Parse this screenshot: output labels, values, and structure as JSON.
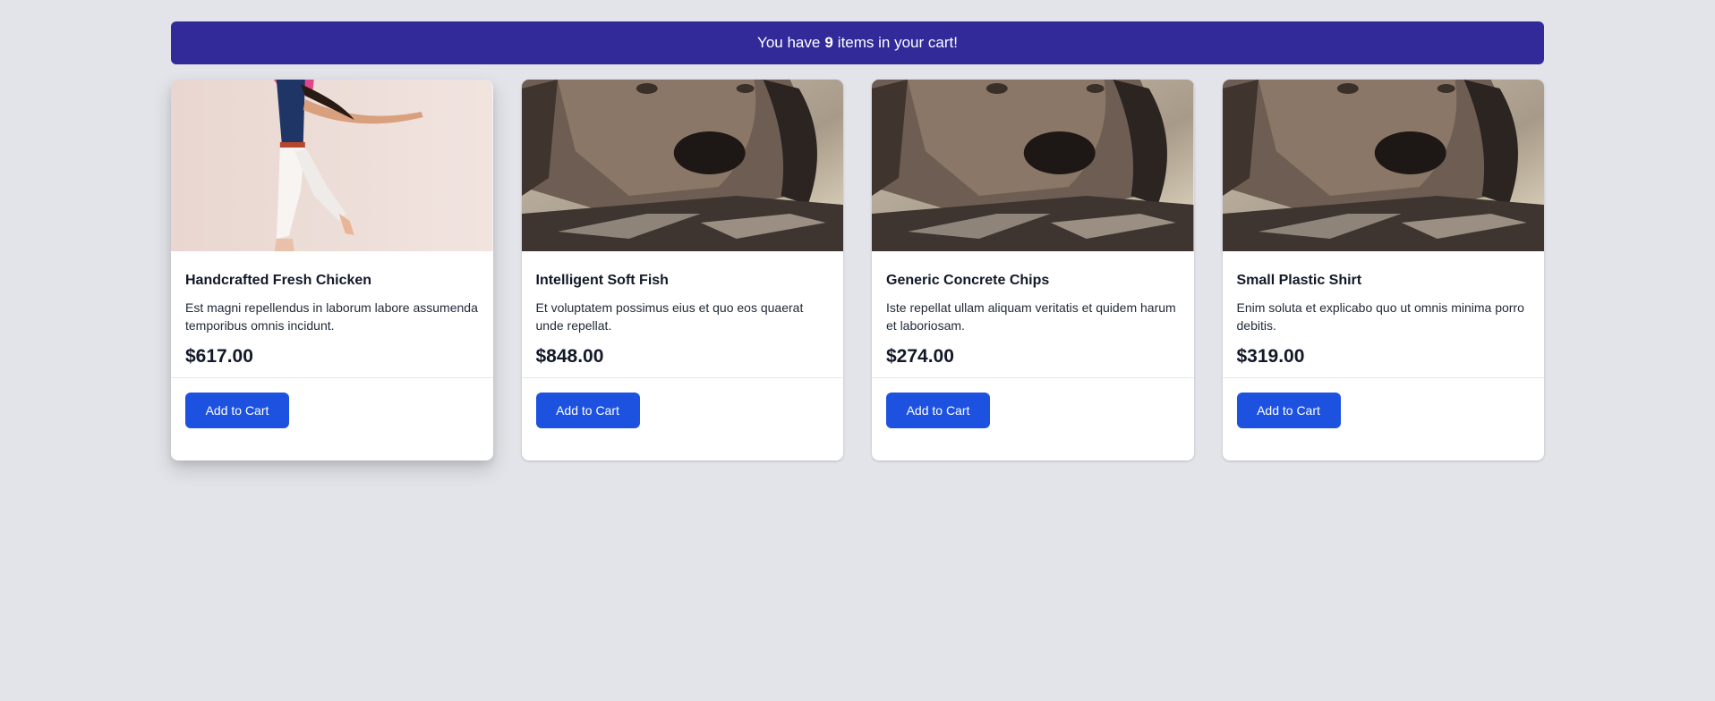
{
  "banner": {
    "prefix": "You have",
    "count": "9",
    "suffix": "items in your cart!",
    "color": "#312a98"
  },
  "products": [
    {
      "title": "Handcrafted Fresh Chicken",
      "description": "Est magni repellendus in laborum labore assumenda temporibus omnis incidunt.",
      "price": "$617.00",
      "button": "Add to Cart",
      "image": "woman-jumping-photo"
    },
    {
      "title": "Intelligent Soft Fish",
      "description": "Et voluptatem possimus eius et quo eos quaerat unde repellat.",
      "price": "$848.00",
      "button": "Add to Cart",
      "image": "dog-resting-photo"
    },
    {
      "title": "Generic Concrete Chips",
      "description": "Iste repellat ullam aliquam veritatis et quidem harum et laboriosam.",
      "price": "$274.00",
      "button": "Add to Cart",
      "image": "dog-resting-photo"
    },
    {
      "title": "Small Plastic Shirt",
      "description": "Enim soluta et explicabo quo ut omnis minima porro debitis.",
      "price": "$319.00",
      "button": "Add to Cart",
      "image": "dog-resting-photo"
    }
  ],
  "colors": {
    "background": "#e2e4e9",
    "button": "#1d52e0"
  }
}
